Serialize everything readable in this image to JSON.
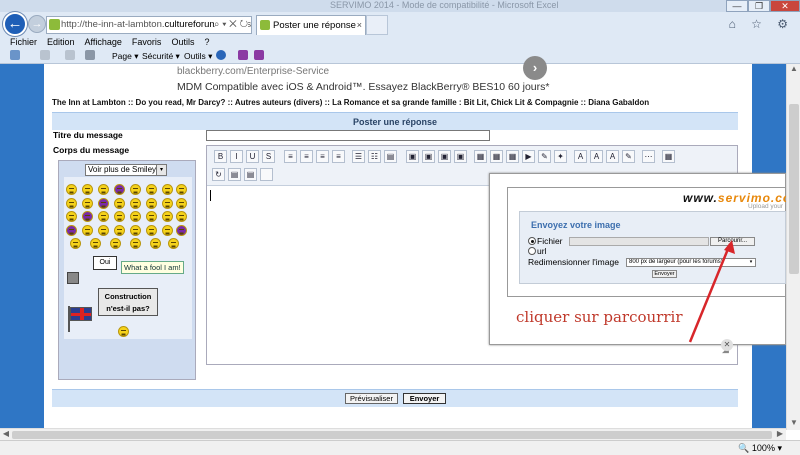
{
  "browser": {
    "window_title": "SERVIMO 2014 - Mode de compatibilité - Microsoft Excel",
    "address": {
      "prefix": "http://the-inn-at-lambton.",
      "domain": "cultureforum.net",
      "suffix": "/pos"
    },
    "address_tools": "⌕ ▾ ✕ ↻",
    "tab_title": "Poster une réponse",
    "tab_close": "×",
    "back_glyph": "←",
    "forward_glyph": "→",
    "window_buttons": {
      "minimize": "—",
      "maximize": "❐",
      "close": "✕"
    },
    "right_icons": "⌂ ☆ ⚙",
    "menu": [
      "Fichier",
      "Edition",
      "Affichage",
      "Favoris",
      "Outils",
      "?"
    ],
    "commands": {
      "page": "Page ▾",
      "securite": "Sécurité ▾",
      "outils": "Outils ▾"
    },
    "zoom": "🔍 100%",
    "zoom_caret": "▾",
    "scroll_up": "▲",
    "scroll_down": "▼",
    "scroll_left": "◀",
    "scroll_right": "▶"
  },
  "ad": {
    "line1": "blackberry.com/Enterprise-Service",
    "line2": "MDM Compatible avec iOS & Android™. Essayez BlackBerry® BES10 60 jours*",
    "button_glyph": "›"
  },
  "breadcrumb": "The Inn at Lambton  :: Do you read, Mr Darcy? :: Autres auteurs (divers) :: La Romance et sa grande famille : Bit Lit, Chick Lit & Compagnie :: Diana Gabaldon",
  "form": {
    "header": "Poster une réponse",
    "title_label": "Titre du message",
    "body_label": "Corps du message",
    "smileys_select": "Voir plus de Smileys",
    "select_caret": "▾",
    "quote_text": "What a fool I am!",
    "oui_sign": "Oui",
    "construction_sign_line1": "Construction",
    "construction_sign_line2": "n'est-il pas?",
    "toolbar_glyphs": [
      "B",
      "I",
      "U",
      "S",
      "≡",
      "≡",
      "≡",
      "≡",
      "☰",
      "☷",
      "▤",
      "▣",
      "▣",
      "▣",
      "▣",
      "▦",
      "▦",
      "▦",
      "▶",
      "✎",
      "✦",
      "A",
      "A",
      "A",
      "✎",
      "⋯",
      "▦",
      "↻",
      "▤",
      "▤"
    ],
    "resize_glyph": "◢",
    "preview_button": "Prévisualiser",
    "send_button": "Envoyer"
  },
  "servimo": {
    "logo_www": "www.",
    "logo_name": "servimo.co",
    "subtitle": "Upload your",
    "title": "Envoyez votre image",
    "radio_file": "Fichier",
    "radio_url": "url",
    "browse_button": "Parcourir...",
    "resize_label": "Redimensionner l'image",
    "resize_value": "800 px de largeur (pour les forums)",
    "send_button": "Envoyer",
    "close_glyph": "✕"
  },
  "annotation": "cliquer sur parcourrir",
  "colors": {
    "page_bg": "#2f76c5",
    "header_bg": "#d3e4f7",
    "annotation": "#c0392b",
    "logo_accent": "#e8880b"
  }
}
